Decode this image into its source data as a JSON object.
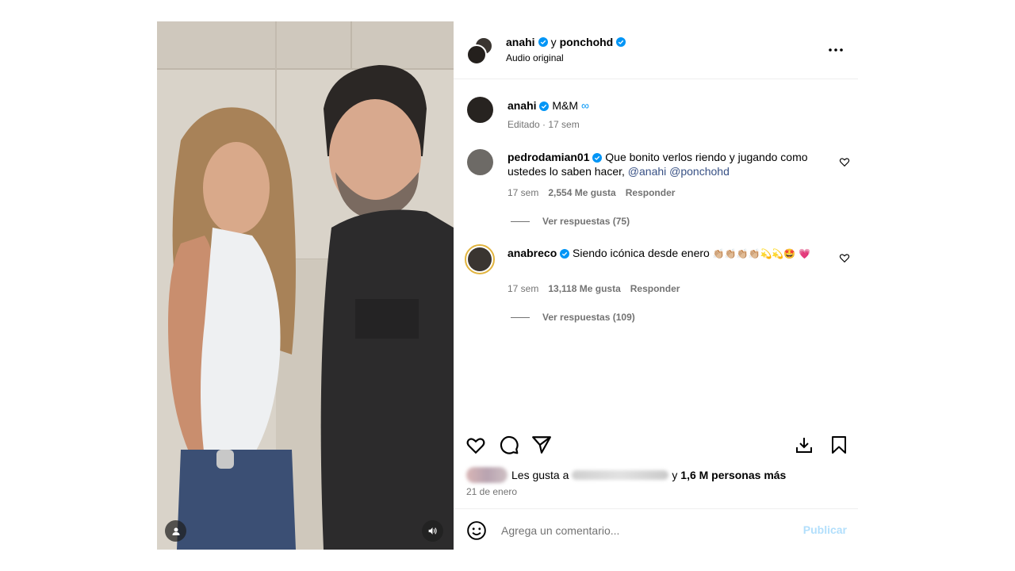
{
  "header": {
    "user1": "anahi",
    "connector": "y",
    "user2": "ponchohd",
    "audio": "Audio original",
    "more_icon": "more-horizontal-icon"
  },
  "caption": {
    "username": "anahi",
    "text": "M&M",
    "suffix_emoji": "∞",
    "meta": "Editado · 17 sem"
  },
  "comments": [
    {
      "username": "pedrodamian01",
      "text": "Que bonito verlos riendo y jugando como ustedes lo saben hacer,",
      "mentions": "@anahi @ponchohd",
      "time": "17 sem",
      "likes": "2,554 Me gusta",
      "reply": "Responder",
      "view_replies": "Ver respuestas (75)"
    },
    {
      "username": "anabreco",
      "text": "Siendo icónica desde enero",
      "emojis": "👏🏼👏🏼👏🏼👏🏼💫💫🤩",
      "emojis2": "💗",
      "time": "17 sem",
      "likes": "13,118 Me gusta",
      "reply": "Responder",
      "view_replies": "Ver respuestas (109)"
    }
  ],
  "likes": {
    "prefix": "Les gusta a",
    "suffix": "y",
    "count": "1,6 M personas más"
  },
  "date": "21 de enero",
  "add_comment": {
    "placeholder": "Agrega un comentario...",
    "publish": "Publicar"
  },
  "colors": {
    "verified": "#0095f6",
    "link": "#385185",
    "muted": "#737373",
    "publish_disabled": "#b2dffc"
  }
}
